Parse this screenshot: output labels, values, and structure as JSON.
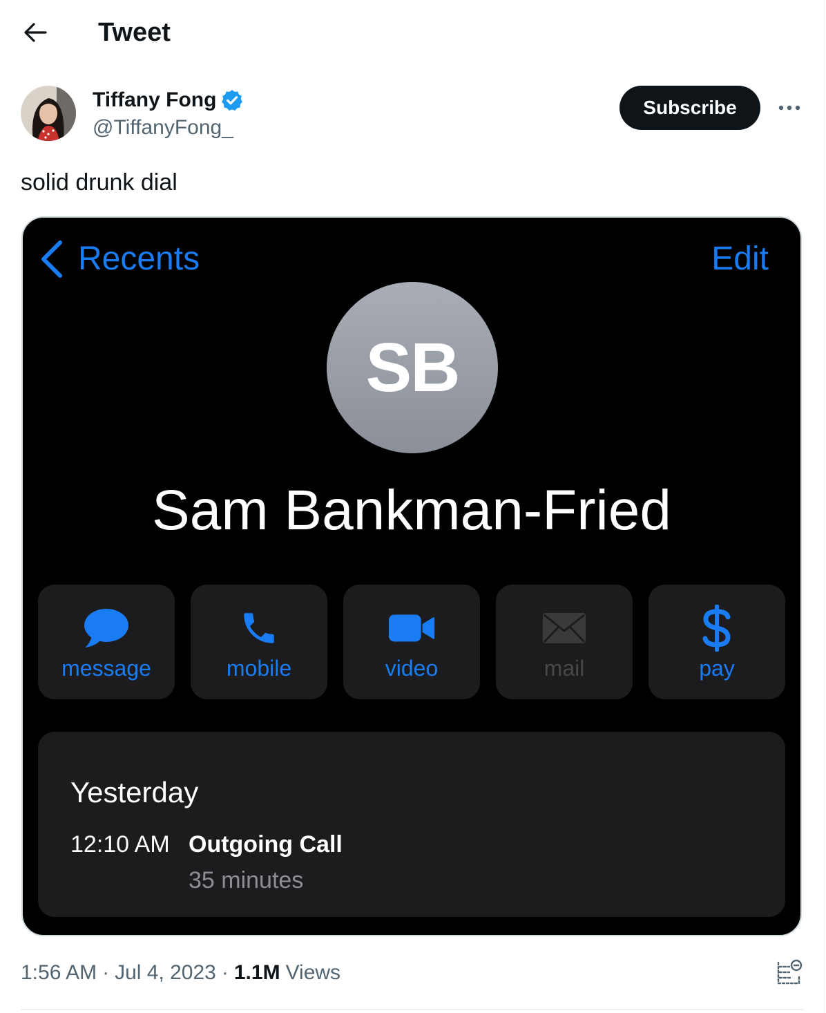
{
  "header": {
    "title": "Tweet",
    "back_icon": "arrow-left-icon"
  },
  "author": {
    "display_name": "Tiffany Fong",
    "handle": "@TiffanyFong_",
    "verified_icon": "verified-badge-icon",
    "subscribe_label": "Subscribe",
    "more_icon": "more-horizontal-icon"
  },
  "tweet": {
    "text": "solid drunk dial"
  },
  "media": {
    "nav": {
      "back_label": "Recents",
      "edit_label": "Edit",
      "back_icon": "chevron-left-icon"
    },
    "contact": {
      "initials": "SB",
      "name": "Sam Bankman-Fried"
    },
    "actions": [
      {
        "label": "message",
        "icon": "message-bubble-icon",
        "enabled": true
      },
      {
        "label": "mobile",
        "icon": "phone-icon",
        "enabled": true
      },
      {
        "label": "video",
        "icon": "video-camera-icon",
        "enabled": true
      },
      {
        "label": "mail",
        "icon": "envelope-icon",
        "enabled": false
      },
      {
        "label": "pay",
        "icon": "dollar-icon",
        "enabled": true
      }
    ],
    "history": {
      "date": "Yesterday",
      "time": "12:10 AM",
      "type": "Outgoing Call",
      "duration": "35 minutes"
    },
    "colors": {
      "ios_blue": "#1a7cf2",
      "cell_bg": "#1c1c1e"
    }
  },
  "meta": {
    "time": "1:56 AM",
    "date": "Jul 4, 2023",
    "views_count": "1.1M",
    "views_label": "Views",
    "analytics_icon": "analytics-icon"
  }
}
